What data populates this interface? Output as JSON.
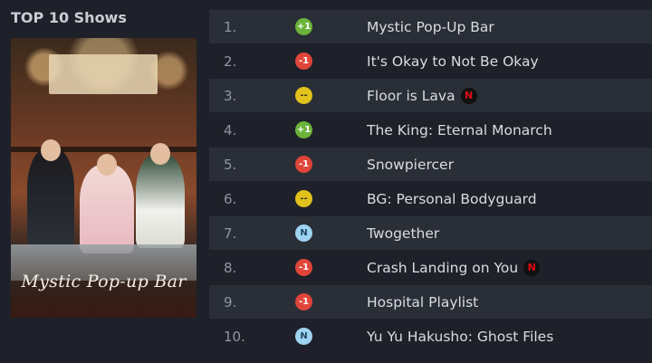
{
  "section": {
    "title": "TOP 10 Shows"
  },
  "poster": {
    "title": "Mystic Pop-up Bar"
  },
  "list": [
    {
      "rank": "1.",
      "badge": "+1",
      "status": "up",
      "title": "Mystic Pop-Up Bar",
      "platform": null
    },
    {
      "rank": "2.",
      "badge": "-1",
      "status": "down",
      "title": "It's Okay to Not Be Okay",
      "platform": null
    },
    {
      "rank": "3.",
      "badge": "--",
      "status": "same",
      "title": "Floor is Lava",
      "platform": "N"
    },
    {
      "rank": "4.",
      "badge": "+1",
      "status": "up",
      "title": "The King: Eternal Monarch",
      "platform": null
    },
    {
      "rank": "5.",
      "badge": "-1",
      "status": "down",
      "title": "Snowpiercer",
      "platform": null
    },
    {
      "rank": "6.",
      "badge": "--",
      "status": "same",
      "title": "BG: Personal Bodyguard",
      "platform": null
    },
    {
      "rank": "7.",
      "badge": "N",
      "status": "new",
      "title": "Twogether",
      "platform": null
    },
    {
      "rank": "8.",
      "badge": "-1",
      "status": "down",
      "title": "Crash Landing on You",
      "platform": "N"
    },
    {
      "rank": "9.",
      "badge": "-1",
      "status": "down",
      "title": "Hospital Playlist",
      "platform": null
    },
    {
      "rank": "10.",
      "badge": "N",
      "status": "new",
      "title": "Yu Yu Hakusho: Ghost Files",
      "platform": null
    }
  ],
  "colors": {
    "background": "#1e2129",
    "row_shade": "#2a2e37",
    "up": "#6bb33b",
    "down": "#e0453a",
    "same": "#e2c21c",
    "new": "#9fd3f2",
    "netflix": "#e50914"
  },
  "icons": {
    "platform_badge": "netflix-icon"
  }
}
